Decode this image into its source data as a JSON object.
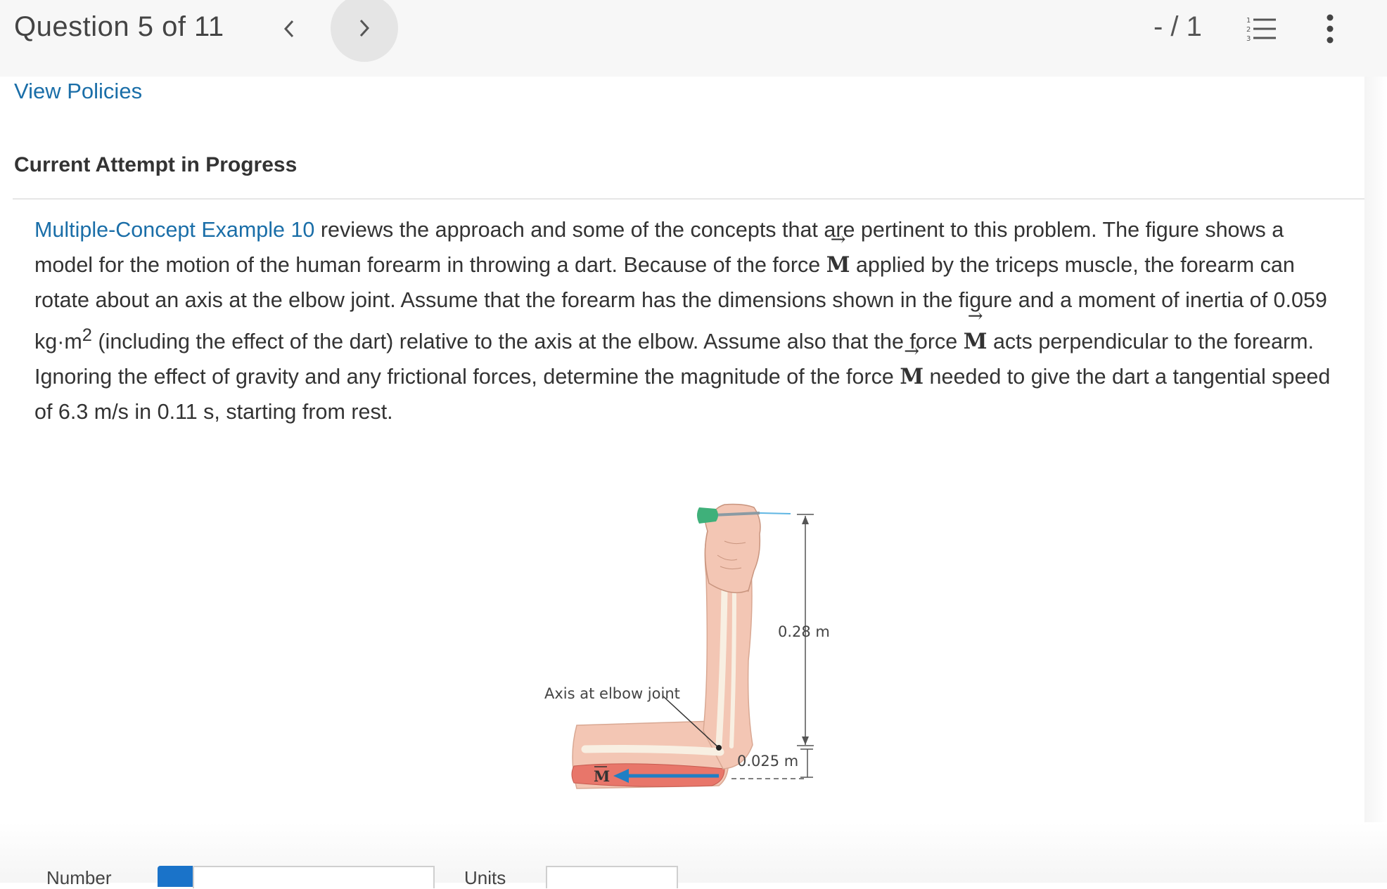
{
  "header": {
    "question_counter": "Question 5 of 11",
    "prev_icon": "chevron-left-icon",
    "next_icon": "chevron-right-icon",
    "score": "- / 1",
    "list_icon": "numbered-list-icon",
    "more_icon": "more-vertical-icon"
  },
  "view_policies": "View Policies",
  "attempt_heading": "Current Attempt in Progress",
  "problem": {
    "link": "Multiple-Concept Example 10",
    "t1": " reviews the approach and some of the concepts that are pertinent to this problem. The figure shows a model for the motion of the human forearm in throwing a dart. Because of the force ",
    "t2": " applied by the triceps muscle, the forearm can rotate about an axis at the elbow joint. Assume that the forearm has the dimensions shown in the figure and a moment of inertia of 0.059 kg·m",
    "t2_sup": "2",
    "t3": " (including the effect of the dart) relative to the axis at the elbow. Assume also that the force ",
    "t4": " acts perpendicular to the forearm. Ignoring the effect of gravity and any frictional forces, determine the magnitude of the force ",
    "t5": " needed to give the dart a tangential speed of 6.3 m/s in 0.11 s, starting from rest.",
    "force_symbol": "M",
    "arrow": "→"
  },
  "figure": {
    "label_length": "0.28 m",
    "label_axis": "Axis at elbow joint",
    "label_offset": "0.025 m",
    "label_force": "M"
  },
  "answer": {
    "number_label": "Number",
    "units_label": "Units"
  },
  "colors": {
    "link": "#1a6ea8",
    "skin": "#f3c6b4",
    "muscle": "#e8766a",
    "force_arrow": "#1f7fc4",
    "dart_flight": "#3fb07a"
  }
}
